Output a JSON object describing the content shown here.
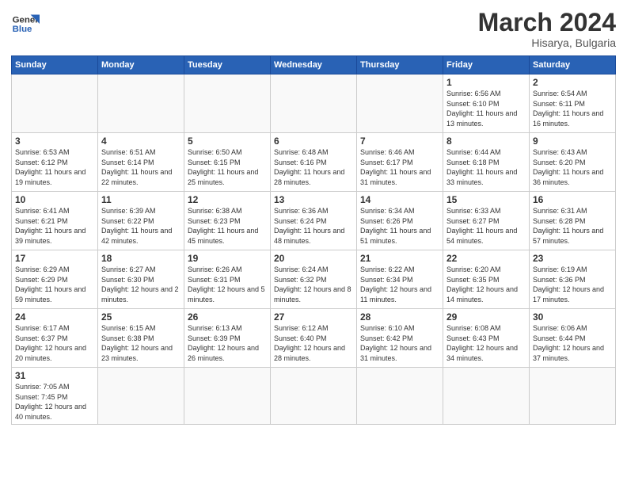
{
  "header": {
    "logo_general": "General",
    "logo_blue": "Blue",
    "title": "March 2024",
    "subtitle": "Hisarya, Bulgaria"
  },
  "weekdays": [
    "Sunday",
    "Monday",
    "Tuesday",
    "Wednesday",
    "Thursday",
    "Friday",
    "Saturday"
  ],
  "weeks": [
    [
      {
        "day": "",
        "info": ""
      },
      {
        "day": "",
        "info": ""
      },
      {
        "day": "",
        "info": ""
      },
      {
        "day": "",
        "info": ""
      },
      {
        "day": "",
        "info": ""
      },
      {
        "day": "1",
        "info": "Sunrise: 6:56 AM\nSunset: 6:10 PM\nDaylight: 11 hours\nand 13 minutes."
      },
      {
        "day": "2",
        "info": "Sunrise: 6:54 AM\nSunset: 6:11 PM\nDaylight: 11 hours\nand 16 minutes."
      }
    ],
    [
      {
        "day": "3",
        "info": "Sunrise: 6:53 AM\nSunset: 6:12 PM\nDaylight: 11 hours\nand 19 minutes."
      },
      {
        "day": "4",
        "info": "Sunrise: 6:51 AM\nSunset: 6:14 PM\nDaylight: 11 hours\nand 22 minutes."
      },
      {
        "day": "5",
        "info": "Sunrise: 6:50 AM\nSunset: 6:15 PM\nDaylight: 11 hours\nand 25 minutes."
      },
      {
        "day": "6",
        "info": "Sunrise: 6:48 AM\nSunset: 6:16 PM\nDaylight: 11 hours\nand 28 minutes."
      },
      {
        "day": "7",
        "info": "Sunrise: 6:46 AM\nSunset: 6:17 PM\nDaylight: 11 hours\nand 31 minutes."
      },
      {
        "day": "8",
        "info": "Sunrise: 6:44 AM\nSunset: 6:18 PM\nDaylight: 11 hours\nand 33 minutes."
      },
      {
        "day": "9",
        "info": "Sunrise: 6:43 AM\nSunset: 6:20 PM\nDaylight: 11 hours\nand 36 minutes."
      }
    ],
    [
      {
        "day": "10",
        "info": "Sunrise: 6:41 AM\nSunset: 6:21 PM\nDaylight: 11 hours\nand 39 minutes."
      },
      {
        "day": "11",
        "info": "Sunrise: 6:39 AM\nSunset: 6:22 PM\nDaylight: 11 hours\nand 42 minutes."
      },
      {
        "day": "12",
        "info": "Sunrise: 6:38 AM\nSunset: 6:23 PM\nDaylight: 11 hours\nand 45 minutes."
      },
      {
        "day": "13",
        "info": "Sunrise: 6:36 AM\nSunset: 6:24 PM\nDaylight: 11 hours\nand 48 minutes."
      },
      {
        "day": "14",
        "info": "Sunrise: 6:34 AM\nSunset: 6:26 PM\nDaylight: 11 hours\nand 51 minutes."
      },
      {
        "day": "15",
        "info": "Sunrise: 6:33 AM\nSunset: 6:27 PM\nDaylight: 11 hours\nand 54 minutes."
      },
      {
        "day": "16",
        "info": "Sunrise: 6:31 AM\nSunset: 6:28 PM\nDaylight: 11 hours\nand 57 minutes."
      }
    ],
    [
      {
        "day": "17",
        "info": "Sunrise: 6:29 AM\nSunset: 6:29 PM\nDaylight: 11 hours\nand 59 minutes."
      },
      {
        "day": "18",
        "info": "Sunrise: 6:27 AM\nSunset: 6:30 PM\nDaylight: 12 hours\nand 2 minutes."
      },
      {
        "day": "19",
        "info": "Sunrise: 6:26 AM\nSunset: 6:31 PM\nDaylight: 12 hours\nand 5 minutes."
      },
      {
        "day": "20",
        "info": "Sunrise: 6:24 AM\nSunset: 6:32 PM\nDaylight: 12 hours\nand 8 minutes."
      },
      {
        "day": "21",
        "info": "Sunrise: 6:22 AM\nSunset: 6:34 PM\nDaylight: 12 hours\nand 11 minutes."
      },
      {
        "day": "22",
        "info": "Sunrise: 6:20 AM\nSunset: 6:35 PM\nDaylight: 12 hours\nand 14 minutes."
      },
      {
        "day": "23",
        "info": "Sunrise: 6:19 AM\nSunset: 6:36 PM\nDaylight: 12 hours\nand 17 minutes."
      }
    ],
    [
      {
        "day": "24",
        "info": "Sunrise: 6:17 AM\nSunset: 6:37 PM\nDaylight: 12 hours\nand 20 minutes."
      },
      {
        "day": "25",
        "info": "Sunrise: 6:15 AM\nSunset: 6:38 PM\nDaylight: 12 hours\nand 23 minutes."
      },
      {
        "day": "26",
        "info": "Sunrise: 6:13 AM\nSunset: 6:39 PM\nDaylight: 12 hours\nand 26 minutes."
      },
      {
        "day": "27",
        "info": "Sunrise: 6:12 AM\nSunset: 6:40 PM\nDaylight: 12 hours\nand 28 minutes."
      },
      {
        "day": "28",
        "info": "Sunrise: 6:10 AM\nSunset: 6:42 PM\nDaylight: 12 hours\nand 31 minutes."
      },
      {
        "day": "29",
        "info": "Sunrise: 6:08 AM\nSunset: 6:43 PM\nDaylight: 12 hours\nand 34 minutes."
      },
      {
        "day": "30",
        "info": "Sunrise: 6:06 AM\nSunset: 6:44 PM\nDaylight: 12 hours\nand 37 minutes."
      }
    ],
    [
      {
        "day": "31",
        "info": "Sunrise: 7:05 AM\nSunset: 7:45 PM\nDaylight: 12 hours\nand 40 minutes."
      },
      {
        "day": "",
        "info": ""
      },
      {
        "day": "",
        "info": ""
      },
      {
        "day": "",
        "info": ""
      },
      {
        "day": "",
        "info": ""
      },
      {
        "day": "",
        "info": ""
      },
      {
        "day": "",
        "info": ""
      }
    ]
  ]
}
